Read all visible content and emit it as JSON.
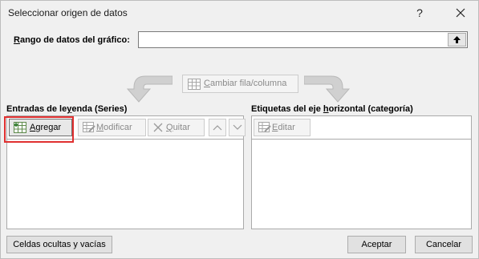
{
  "window": {
    "title": "Seleccionar origen de datos",
    "help_glyph": "?",
    "close_icon": "close-icon"
  },
  "range": {
    "label_pre": "",
    "label_u": "R",
    "label_post": "ango de datos del gráfico:",
    "value": "",
    "collapse_icon": "collapse-dialog-icon"
  },
  "switch_button": {
    "pre": "",
    "u": "C",
    "post": "ambiar fila/columna",
    "enabled": false
  },
  "series_panel": {
    "label_pre": "Entradas de le",
    "label_u": "y",
    "label_post": "enda (Series)",
    "buttons": {
      "add": {
        "pre": "",
        "u": "A",
        "post": "gregar"
      },
      "modify": {
        "pre": "",
        "u": "M",
        "post": "odificar"
      },
      "remove": {
        "pre": "",
        "u": "Q",
        "post": "uitar"
      }
    },
    "items": []
  },
  "category_panel": {
    "label_pre": "Etiquetas del eje ",
    "label_u": "h",
    "label_post": "orizontal (categoría)",
    "edit": {
      "pre": "",
      "u": "E",
      "post": "ditar"
    },
    "items": []
  },
  "footer": {
    "hidden_cells": "Celdas ocultas y vacías",
    "ok": "Aceptar",
    "cancel": "Cancelar"
  },
  "colors": {
    "highlight": "#e03030",
    "disabled_text": "#8a8a8a",
    "dialog_bg": "#f0f0f0"
  }
}
